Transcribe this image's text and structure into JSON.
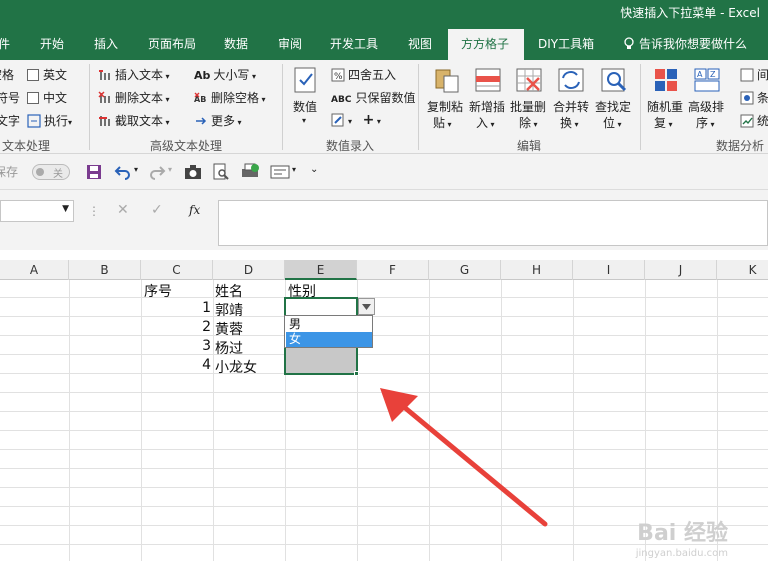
{
  "title": "快速插入下拉菜单 - Excel",
  "tabs": [
    "件",
    "开始",
    "插入",
    "页面布局",
    "数据",
    "审阅",
    "开发工具",
    "视图",
    "方方格子",
    "DIY工具箱"
  ],
  "tell_me": "告诉我你想要做什么",
  "ribbon": {
    "g1": {
      "items": [
        "空格",
        "符号",
        "文字"
      ],
      "label": "文本处理"
    },
    "g2": {
      "items": [
        "英文",
        "中文",
        "执行"
      ]
    },
    "g3": {
      "items": [
        "插入文本",
        "删除文本",
        "截取文本"
      ]
    },
    "g4": {
      "items": [
        "大小写",
        "删除空格",
        "更多"
      ],
      "label": "高级文本处理"
    },
    "g5": {
      "big": "数值",
      "items": [
        "四舍五入",
        "只保留数值"
      ],
      "label": "数值录入"
    },
    "g6": {
      "buttons": [
        {
          "l1": "复制粘",
          "l2": "贴"
        },
        {
          "l1": "新增插",
          "l2": "入"
        },
        {
          "l1": "批量删",
          "l2": "除"
        },
        {
          "l1": "合并转",
          "l2": "换"
        },
        {
          "l1": "查找定",
          "l2": "位"
        }
      ],
      "label": "编辑"
    },
    "g7": {
      "buttons": [
        {
          "l1": "随机重",
          "l2": "复"
        },
        {
          "l1": "高级排",
          "l2": "序"
        }
      ],
      "items": [
        "间",
        "条",
        "统"
      ],
      "label": "数据分析"
    }
  },
  "qat": {
    "autosave": "保存",
    "toggle": "关"
  },
  "formula": {
    "fx": "fx"
  },
  "columns": [
    "A",
    "B",
    "C",
    "D",
    "E",
    "F",
    "G",
    "H",
    "I",
    "J",
    "K"
  ],
  "table": {
    "headers": [
      "序号",
      "姓名",
      "性别"
    ],
    "rows": [
      {
        "no": "1",
        "name": "郭靖"
      },
      {
        "no": "2",
        "name": "黄蓉"
      },
      {
        "no": "3",
        "name": "杨过"
      },
      {
        "no": "4",
        "name": "小龙女"
      }
    ]
  },
  "dropdown": {
    "options": [
      "男",
      "女"
    ],
    "highlighted": "女"
  },
  "watermark": {
    "main": "Bai 经验",
    "sub": "jingyan.baidu.com"
  },
  "colors": {
    "excel_green": "#217346",
    "selection": "#3c95e6",
    "arrow": "#e8413a"
  }
}
